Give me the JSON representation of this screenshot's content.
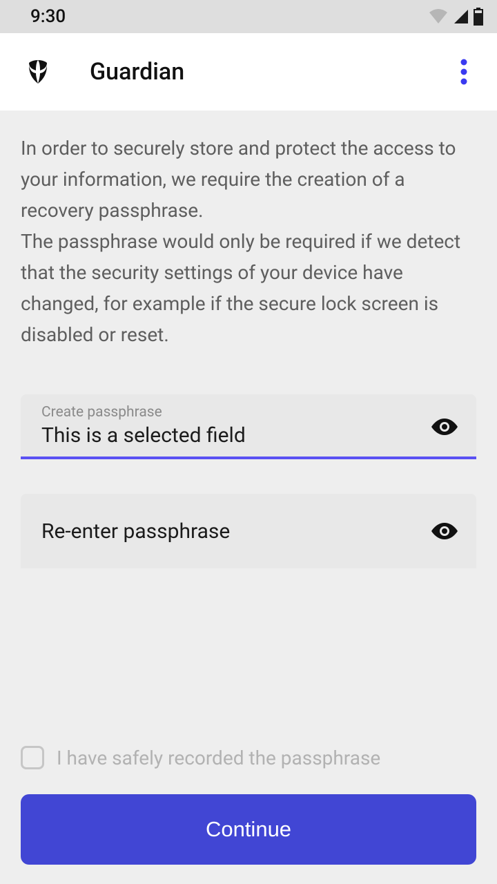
{
  "status": {
    "time": "9:30"
  },
  "app": {
    "title": "Guardian"
  },
  "intro": {
    "p1": "In order to securely store and protect the access to your information, we require the creation of a recovery passphrase.",
    "p2": "The passphrase would only be required if we detect that the security settings of your device have changed, for example if the secure lock screen is disabled or reset."
  },
  "field1": {
    "label": "Create passphrase",
    "value": "This is a selected field"
  },
  "field2": {
    "label": "Re-enter passphrase"
  },
  "confirm": {
    "label": "I have safely recorded the passphrase"
  },
  "button": {
    "continue": "Continue"
  }
}
